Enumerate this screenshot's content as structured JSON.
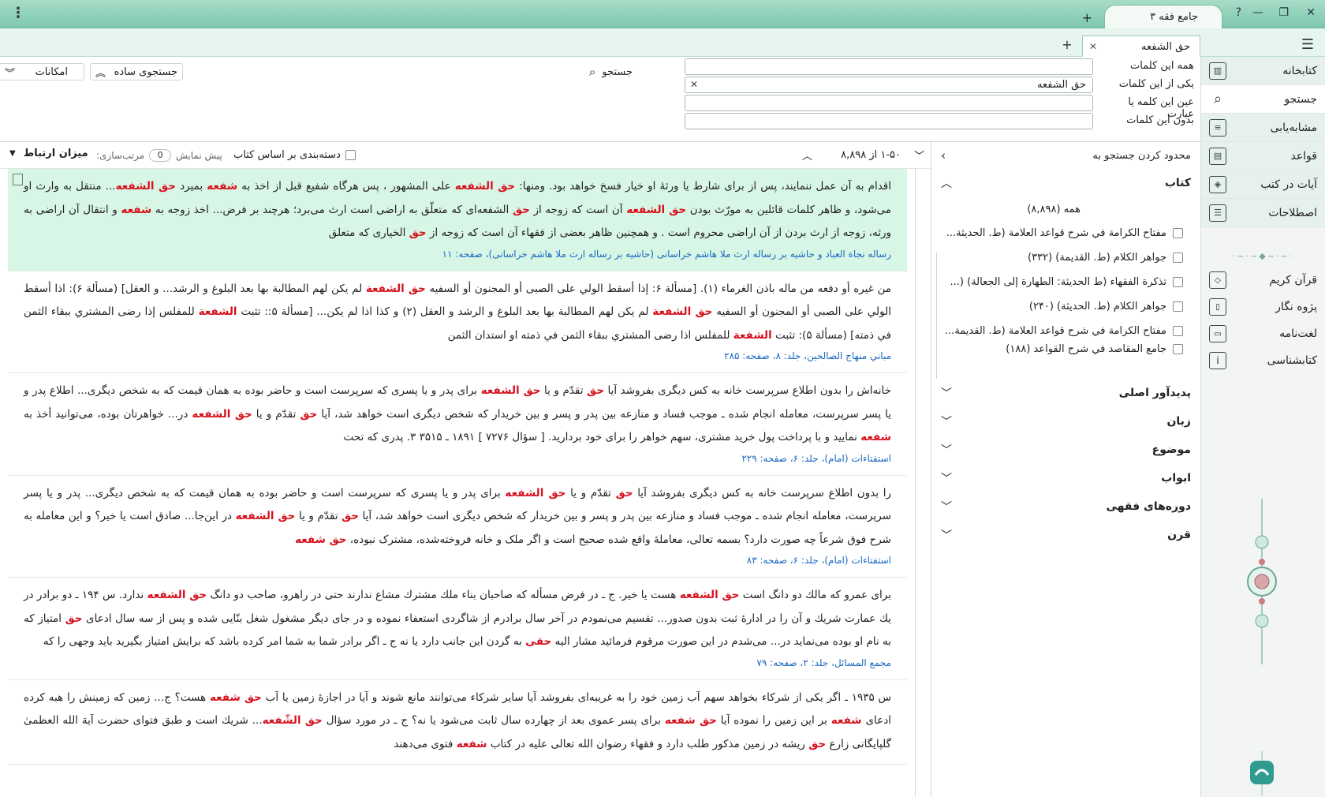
{
  "window": {
    "app_tab": "جامع فقه ۳",
    "doc_tab": "حق الشفعه"
  },
  "sidebar": {
    "items": [
      {
        "label": "کتابخانه",
        "icon": "library-icon"
      },
      {
        "label": "جستجو",
        "icon": "search-icon"
      },
      {
        "label": "مشابه‌یابی",
        "icon": "similar-icon"
      },
      {
        "label": "قواعد",
        "icon": "rules-icon"
      },
      {
        "label": "آیات در کتب",
        "icon": "verses-icon"
      },
      {
        "label": "اصطلاحات",
        "icon": "terms-icon"
      }
    ],
    "items2": [
      {
        "label": "قرآن کریم",
        "icon": "quran-icon"
      },
      {
        "label": "پژوه نگار",
        "icon": "notes-icon"
      },
      {
        "label": "لغت‌نامه",
        "icon": "dictionary-icon"
      },
      {
        "label": "کتابشناسی",
        "icon": "info-icon"
      }
    ]
  },
  "search": {
    "fields": [
      {
        "label": "همه این کلمات",
        "value": ""
      },
      {
        "label": "یکی از این کلمات",
        "value": "حق الشفعه"
      },
      {
        "label": "عین این کلمه یا عبارت",
        "value": ""
      },
      {
        "label": "بدون این کلمات",
        "value": ""
      }
    ],
    "search_label": "جستجو",
    "simple_label": "جستجوی ساده",
    "options_label": "امکانات"
  },
  "filter": {
    "head": "محدود کردن جستجو به",
    "books_title": "کتاب",
    "all_books": "همه (۸,۸۹۸)",
    "books": [
      "مفتاح الكرامة في شرح قواعد العلامة (ط. الحديثة...",
      "جواهر الكلام (ط. القديمة) (۳۳۲)",
      "تذكرة الفقهاء (ط الحديثة: الطهارة إلى الجعالة) (...",
      "جواهر الكلام (ط. الحديثة) (۲۴۰)",
      "مفتاح الكرامة في شرح قواعد العلامة (ط. القديمة...",
      "جامع المقاصد في شرح القواعد (۱۸۸)"
    ],
    "sections": [
      "پدیدآور اصلی",
      "زبان",
      "موضوع",
      "ابواب",
      "دوره‌های فقهی",
      "قرن"
    ]
  },
  "results": {
    "count": "۱-۵۰ از ۸,۸۹۸",
    "group_label": "دسته‌بندی بر اساس کتاب",
    "preview_label": "پیش نمایش",
    "preview_value": "0",
    "sort_label": "مرتب‌سازی:",
    "sort_value": "میزان ارتباط",
    "items": [
      {
        "highlight": true,
        "parts": [
          "اقدام به آن عمل ننمایند، پس از برای شارط یا ورثهٔ او خیار فسخ خواهد بود. ومنها: ",
          "*حق الشفعه",
          " على المشهور ، پس هرگاه شفیع قبل از اخذ به ",
          "*شفعه",
          " بمیرد ",
          "*حق الشفعه",
          "... منتقل به وارث او می‌شود، و ظاهر کلمات قائلین به مورّث بودن ",
          "*حق الشفعه",
          " آن است که زوجه از ",
          "*حق",
          " الشفعه‌ای که متعلّق به اراضی است ارث می‌برد؛ هرچند بر فرض... اخذ زوجه به ",
          "*شفعه",
          " و انتقال آن اراضی به ورثه، زوجه از ارث بردن از آن اراضی محروم است . و همچنین ظاهر بعضی از فقهاء آن است که زوجه از ",
          "*حق",
          " الخیاری که متعلق"
        ],
        "source": "رساله نجاة العباد و حاشیه بر رساله ارث ملا هاشم خراسانی (حاشیه بر رساله ارث ملا هاشم خراسانی)، صفحه: ۱۱"
      },
      {
        "highlight": false,
        "parts": [
          "من غيره أو دفعه من ماله باذن الغرماء (۱). [مسألة ۶: إذا أسقط الولي على الصبى أو المجنون أو السفيه ",
          "*حق الشفعة",
          " لم يكن لهم المطالبة بها بعد البلوغ و الرشد... و العقل] (مسألة ۶): اذا أسقط الولي على الصبى أو المجنون أو السفيه ",
          "*حق الشفعة",
          " لم يكن لهم المطالبة بها بعد البلوغ و الرشد و العقل (۲) و كذا اذا لم يكن... [مسألة ۵:: تثبت ",
          "*الشفعة",
          " للمفلس إذا رضى المشتري ببقاء الثمن في ذمته] (مسألة ۵): تثبت ",
          "*الشفعة",
          " للمفلس اذا رضى المشتري ببقاء الثمن في ذمته او استدان الثمن"
        ],
        "source": "مباني منهاج الصالحين، جلد: ۸، صفحه: ۲۸۵"
      },
      {
        "highlight": false,
        "parts": [
          "خانه‌اش را بدون اطلاع سرپرست خانه به کس دیگری بفروشد آیا ",
          "*حق",
          " تقدّم و یا ",
          "*حق الشفعه",
          " برای پدر و یا پسری که سرپرست است و حاضر بوده به همان قیمت که به شخص دیگری... اطلاع پدر و یا پسر سرپرست، معامله انجام شده ـ موجب فساد و منازعه بین پدر و پسر و بین خریدار که شخص دیگری است خواهد شد، آیا ",
          "*حق",
          " تقدّم و یا ",
          "*حق الشفعه",
          " در... خواهرتان بوده، می‌توانید أخذ به ",
          "*شفعه",
          " نمایید و با پرداخت پول خرید مشتری، سهم خواهر را برای خود بردارید. [ سؤال ۷۲۷۶ ] ۱۸۹۱ ـ ۳۵۱۵ ۳. پدری که تحت"
        ],
        "source": "استفتاءات (امام)، جلد: ۶، صفحه: ۲۲۹"
      },
      {
        "highlight": false,
        "parts": [
          "را بدون اطلاع سرپرست خانه به کس دیگری بفروشد آیا ",
          "*حق",
          " تقدّم و یا ",
          "*حق الشفعه",
          " برای پدر و یا پسری که سرپرست است و حاضر بوده به همان قیمت که به شخص دیگری... پدر و یا پسر سرپرست، معامله انجام شده ـ موجب فساد و منازعه بین پدر و پسر و بین خریدار که شخص دیگری است خواهد شد، آیا ",
          "*حق",
          " تقدّم و یا ",
          "*حق الشفعه",
          " در این‌جا... صادق است یا خیر؟ و این معامله به شرح فوق شرعاً چه صورت دارد؟ بسمه تعالى، معاملهٔ واقع شده صحیح است و اگر ملک و خانه فروخته‌شده، مشترک نبوده، ",
          "*حق شفعه"
        ],
        "source": "استفتاءات (امام)، جلد: ۶، صفحه: ۸۳"
      },
      {
        "highlight": false,
        "parts": [
          "برای عمرو که مالك دو دانگ است ",
          "*حق الشفعه",
          " هست یا خیر. ج ـ در فرض مسأله که صاحبان بناء ملك مشترك مشاع ندارند حتی در راهرو، صاحب دو دانگ ",
          "*حق الشفعه",
          " ندارد. س ۱۹۴ ـ دو برادر در يك عمارت شريك و آن را در ادارهٔ ثبت بدون صدور... تقسيم مى‌نمودم در آخر سال برادرم از شاگردى استعفاء نموده و در جاى ديگر مشغول شغل بنّايى شده و پس از سه سال ادعاى ",
          "*حق",
          " امتياز كه به نام او بوده مى‌نمايد در... مى‌شدم در اين صورت مرقوم فرمائيد مشار اليه ",
          "*حقى",
          " به گردن اين جانب دارد يا نه ج ـ اگر برادر شما به شما امر كرده باشد كه برايش امتياز بگيريد بايد وجهى را كه"
        ],
        "source": "مجمع المسائل، جلد: ۲، صفحه: ۷۹"
      },
      {
        "highlight": false,
        "parts": [
          "س ۱۹۳۵ ـ اگر يكى از شركاء بخواهد سهم آب زمين خود را به غريبه‌اى بفروشد آيا ساير شركاء مى‌توانند مانع شوند و آيا در اجازهٔ زمين يا آب ",
          "*حق شفعه",
          " هست؟ ج... زمين كه زمينش را هبه كرده ادعاى ",
          "*شفعه",
          " بر اين زمين را نموده آيا ",
          "*حق شفعه",
          " براى پسر عموى بعد از چهارده سال ثابت مى‌شود يا نه؟ ج ـ در مورد سؤال ",
          "*حق الشّفعه",
          "... شريك است و طبق فتواى حضرت آية الله العظمىٰ گلپايگانى زارع ",
          "*حق",
          " ريشه در زمين مذكور طلب دارد و فقهاء رضوان الله تعالى عليه در كتاب ",
          "*شفعه",
          " فتوى مى‌دهند"
        ],
        "source": ""
      }
    ]
  }
}
